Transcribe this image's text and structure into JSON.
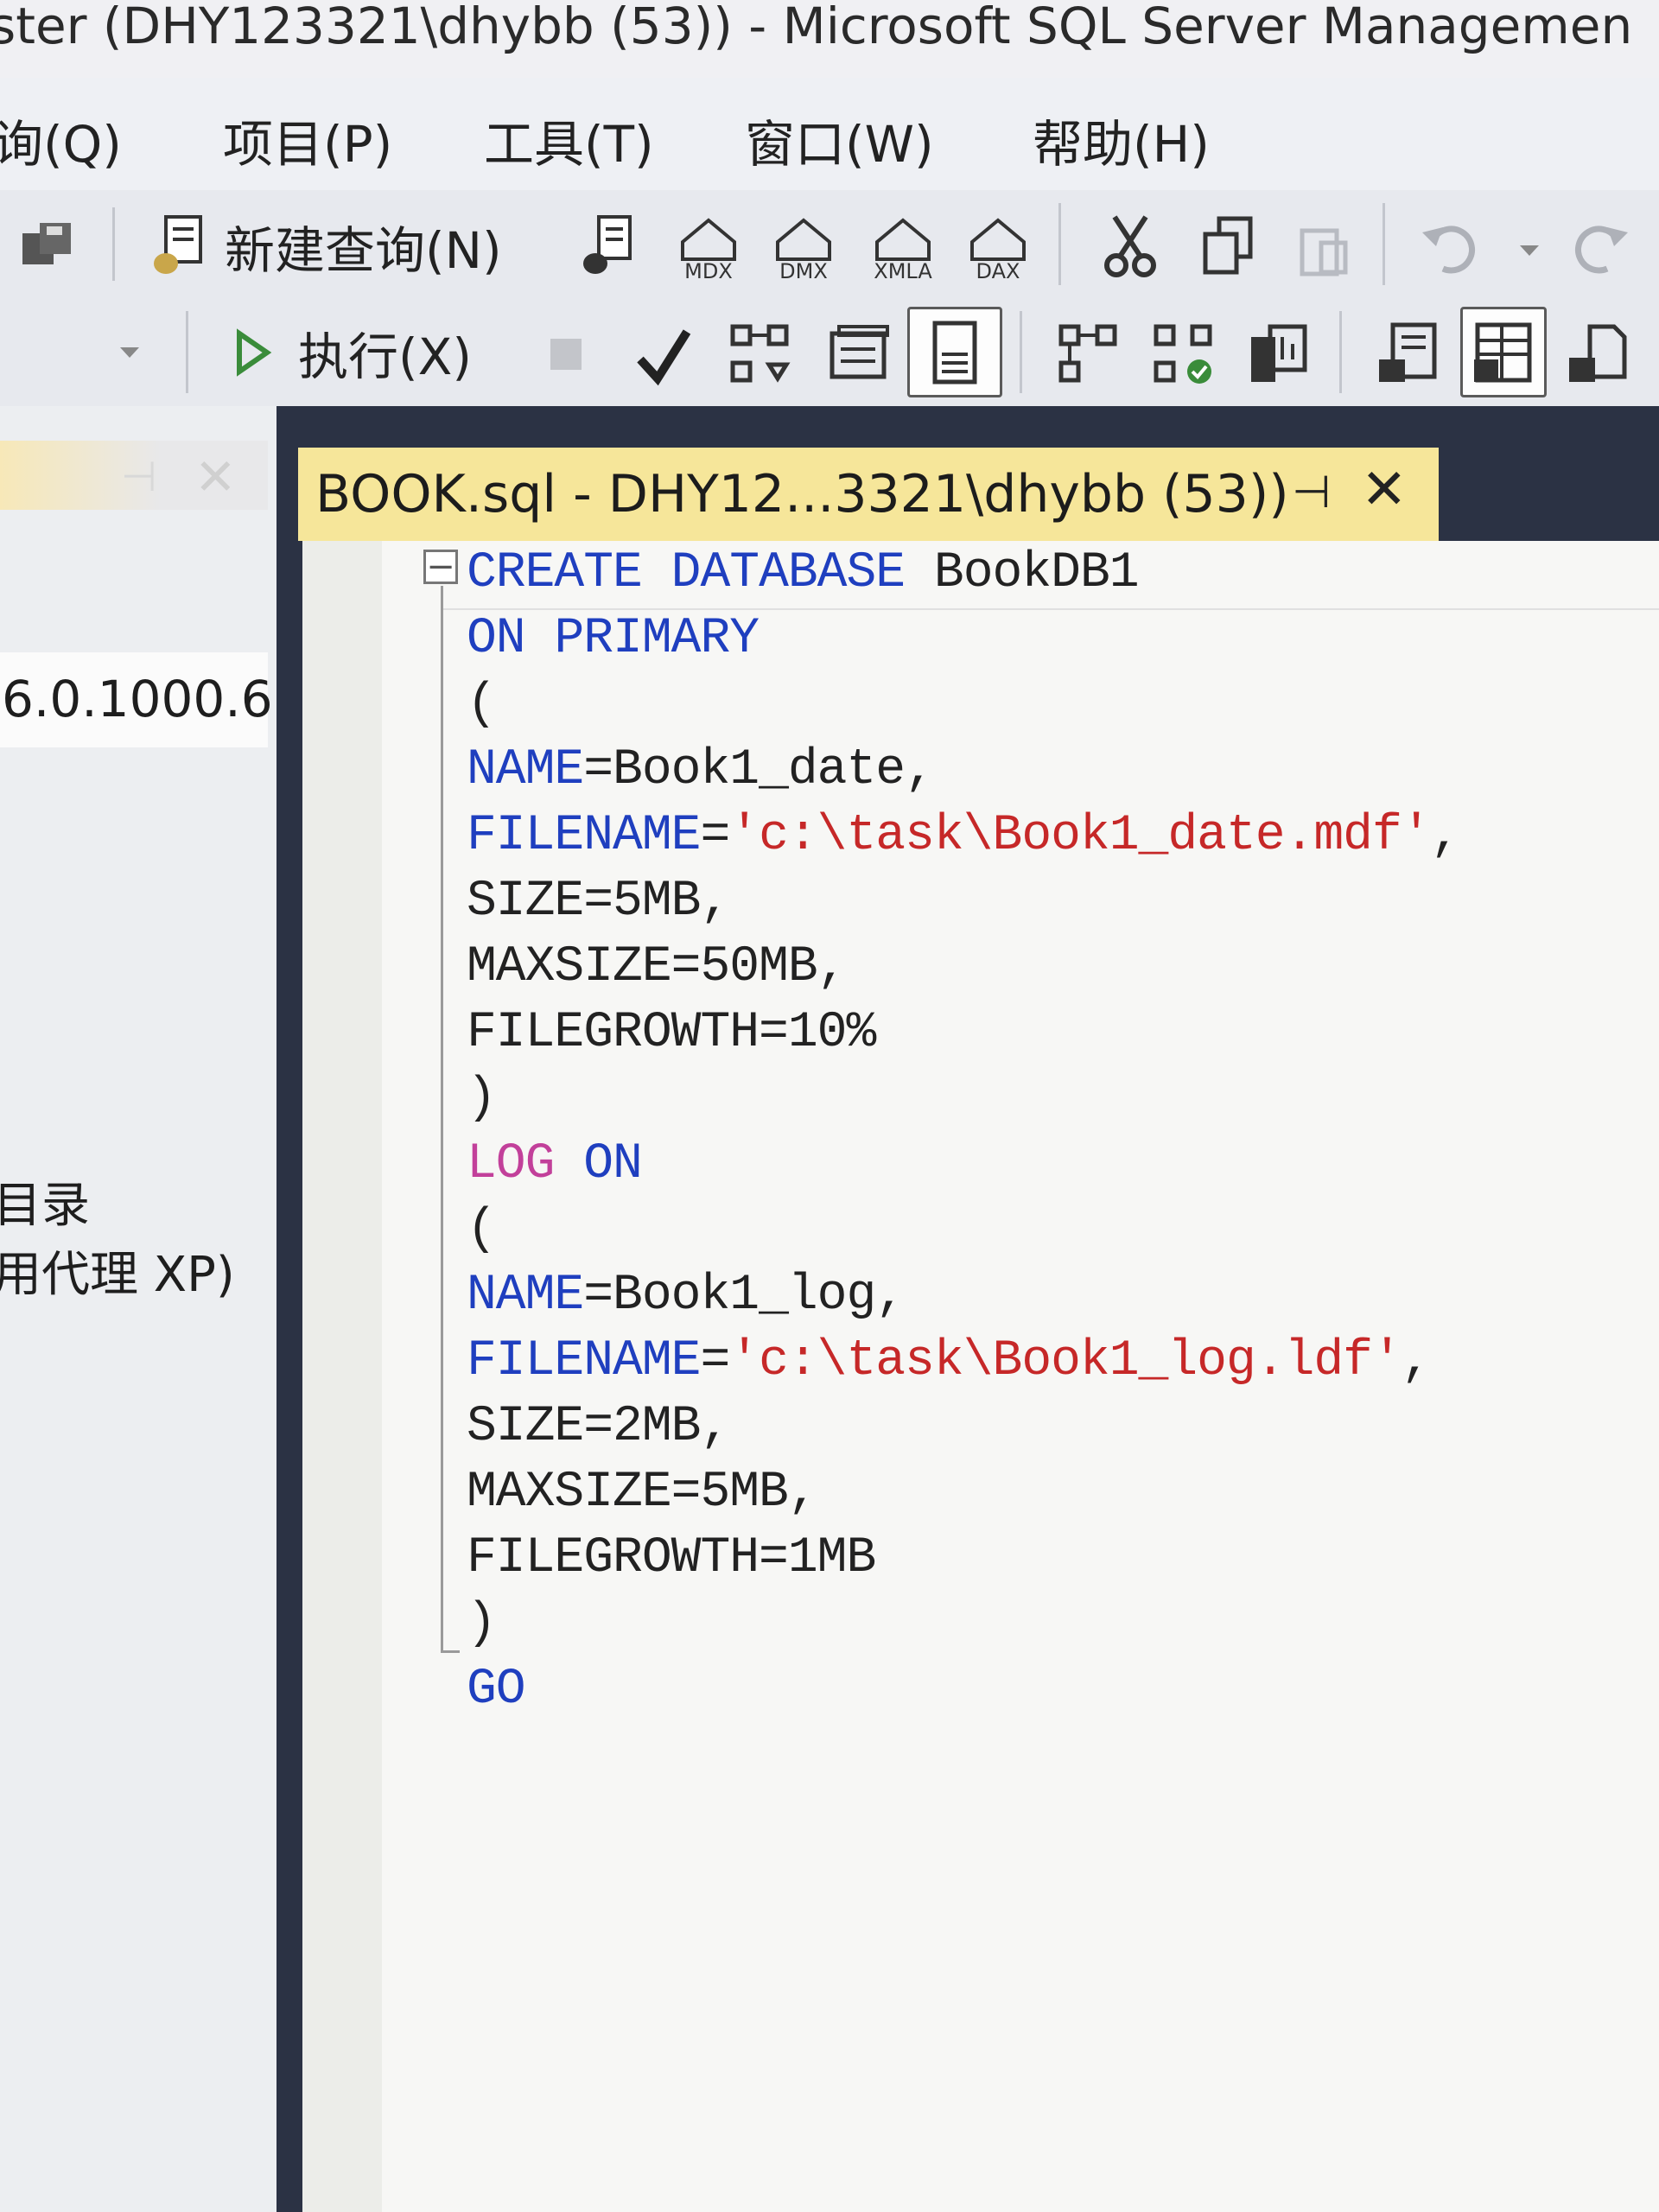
{
  "window": {
    "title": "ster (DHY123321\\dhybb (53)) - Microsoft SQL Server Managemen"
  },
  "menu": {
    "items": [
      "询(Q)",
      "项目(P)",
      "工具(T)",
      "窗口(W)",
      "帮助(H)"
    ]
  },
  "toolbar": {
    "new_query_label": "新建查询(N)",
    "execute_label": "执行(X)",
    "query_type_icons": [
      "MDX",
      "DMX",
      "XMLA",
      "DAX"
    ]
  },
  "left_panel": {
    "version": "6.0.1000.6",
    "item1": "目录",
    "item2": "用代理 XP)"
  },
  "tab": {
    "title": "BOOK.sql - DHY12...3321\\dhybb (53))"
  },
  "code": {
    "lines": [
      "CREATE DATABASE BookDB1",
      "ON PRIMARY",
      "(",
      "NAME=Book1_date,",
      "FILENAME='c:\\task\\Book1_date.mdf',",
      "SIZE=5MB,",
      "MAXSIZE=50MB,",
      "FILEGROWTH=10%",
      ")",
      "LOG ON",
      "(",
      "NAME=Book1_log,",
      "FILENAME='c:\\task\\Book1_log.ldf',",
      "SIZE=2MB,",
      "MAXSIZE=5MB,",
      "FILEGROWTH=1MB",
      ")",
      "GO"
    ],
    "tokens": {
      "create": "CREATE",
      "database": "DATABASE",
      "dbname": " BookDB1",
      "on": "ON",
      "primary": "PRIMARY",
      "lparen": "(",
      "rparen": ")",
      "name": "NAME",
      "filename": "FILENAME",
      "eq": "=",
      "data_name_val": "Book1_date,",
      "data_file": "'c:\\task\\Book1_date.mdf'",
      "comma": ",",
      "size": "SIZE=5MB,",
      "maxsize": "MAXSIZE=50MB,",
      "filegrowth": "FILEGROWTH=10%",
      "log": "LOG",
      "log_name_val": "Book1_log,",
      "log_file": "'c:\\task\\Book1_log.ldf'",
      "log_size": "SIZE=2MB,",
      "log_maxsize": "MAXSIZE=5MB,",
      "log_filegrowth": "FILEGROWTH=1MB",
      "go": "GO"
    }
  },
  "colors": {
    "keyword": "#1f3fbf",
    "system_keyword": "#c2409a",
    "string": "#c62828",
    "tab_active": "#f6e69a"
  }
}
